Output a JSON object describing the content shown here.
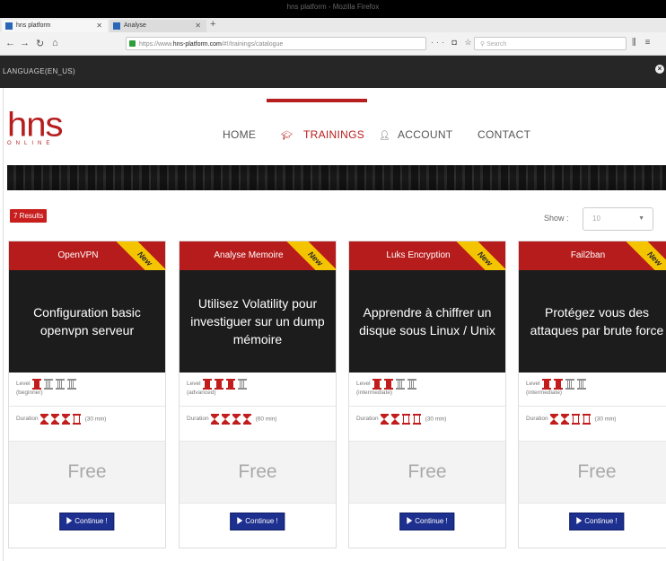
{
  "browser": {
    "window_title": "hns platform - Mozilla Firefox",
    "tabs": [
      {
        "label": "hns platform",
        "active": true
      },
      {
        "label": "Analyse",
        "active": false
      }
    ],
    "url_prefix": "https://www.",
    "url_host": "hns-platform.com",
    "url_path": "/#!/trainings/catalogue",
    "search_placeholder": "Search"
  },
  "site": {
    "language_label": "LANGUAGE(EN_US)",
    "logo_text": "hns",
    "logo_sub": "ONLINE",
    "nav": [
      {
        "label": "HOME"
      },
      {
        "label": "TRAININGS",
        "active": true
      },
      {
        "label": "ACCOUNT"
      },
      {
        "label": "CONTACT"
      }
    ],
    "results_badge": "7 Results",
    "show_label": "Show :",
    "show_value": "10",
    "accent_color": "#b61d1d",
    "button_color": "#1d2f8f",
    "ribbon_color": "#f5c400"
  },
  "cards": [
    {
      "title": "OpenVPN",
      "ribbon": "New",
      "description": "Configuration basic openvpn serveur",
      "level_label": "Level",
      "level_value": "(beginner)",
      "level": 1,
      "level_max": 4,
      "duration_label": "Duration",
      "duration_value": "(30 min)",
      "duration": 3,
      "duration_max": 4,
      "price": "Free",
      "button": "Continue !"
    },
    {
      "title": "Analyse Memoire",
      "ribbon": "New",
      "description": "Utilisez Volatility pour investiguer sur un dump mémoire",
      "level_label": "Level",
      "level_value": "(advanced)",
      "level": 3,
      "level_max": 4,
      "duration_label": "Duration",
      "duration_value": "(60 min)",
      "duration": 4,
      "duration_max": 4,
      "price": "Free",
      "button": "Continue !"
    },
    {
      "title": "Luks Encryption",
      "ribbon": "New",
      "description": "Apprendre à chiffrer un disque sous Linux / Unix",
      "level_label": "Level",
      "level_value": "(intermediate)",
      "level": 2,
      "level_max": 4,
      "duration_label": "Duration",
      "duration_value": "(30 min)",
      "duration": 2,
      "duration_max": 4,
      "price": "Free",
      "button": "Continue !"
    },
    {
      "title": "Fail2ban",
      "ribbon": "New",
      "description": "Protégez vous des attaques par brute force",
      "level_label": "Level",
      "level_value": "(intermediate)",
      "level": 2,
      "level_max": 4,
      "duration_label": "Duration",
      "duration_value": "(30 min)",
      "duration": 2,
      "duration_max": 4,
      "price": "Free",
      "button": "Continue !"
    }
  ]
}
